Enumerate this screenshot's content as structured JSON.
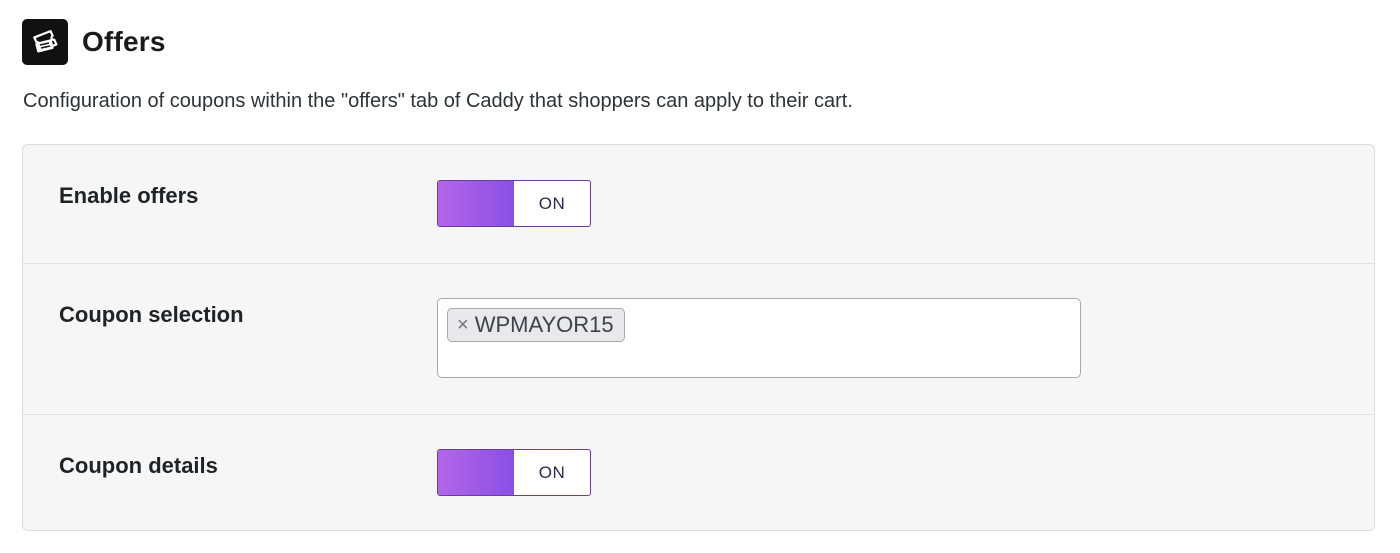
{
  "header": {
    "title": "Offers",
    "icon": "ticket-icon"
  },
  "description": "Configuration of coupons within the \"offers\" tab of Caddy that shoppers can apply to their cart.",
  "settings": {
    "enable_offers": {
      "label": "Enable offers",
      "state": "ON"
    },
    "coupon_selection": {
      "label": "Coupon selection",
      "selected": [
        {
          "remove_glyph": "×",
          "label": "WPMAYOR15"
        }
      ]
    },
    "coupon_details": {
      "label": "Coupon details",
      "state": "ON"
    }
  },
  "colors": {
    "toggle_gradient_start": "#b366e8",
    "toggle_gradient_end": "#8a4fe6",
    "toggle_border": "#6a3ea1",
    "panel_background": "#f6f6f7"
  }
}
